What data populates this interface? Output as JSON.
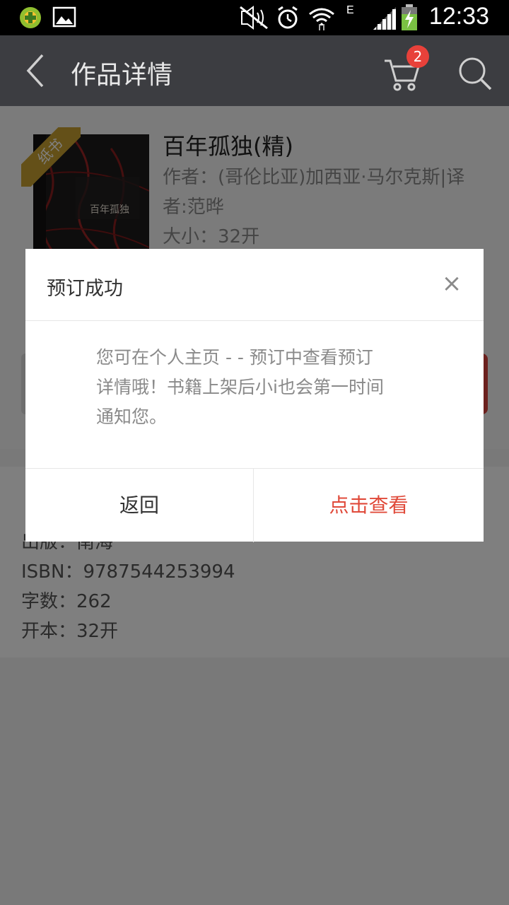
{
  "status_bar": {
    "time": "12:33",
    "icons": [
      "app-notification-icon",
      "image-notification-icon",
      "mute-icon",
      "alarm-icon",
      "wifi-icon",
      "network-e-icon",
      "signal-icon",
      "battery-charging-icon"
    ],
    "network_label": "E"
  },
  "app_bar": {
    "title": "作品详情",
    "cart_badge": "2"
  },
  "book": {
    "ribbon": "纸书",
    "cover_title": "百年孤独",
    "cover_spine": "孤独",
    "title": "百年孤独(精)",
    "author_line1": "作者：(哥伦比亚)加西亚·马尔克斯|译",
    "author_line2": "者:范晔",
    "size": "大小：32开"
  },
  "info": {
    "line_publisher": "出版：南海",
    "isbn": "ISBN：9787544253994",
    "word_count": "字数：262",
    "format": "开本：32开"
  },
  "dialog": {
    "title": "预订成功",
    "close_symbol": "×",
    "message_line1": "您可在个人主页 -  - 预订中查看预订",
    "message_line2": "详情哦！书籍上架后小i也会第一时间",
    "message_line3": "通知您。",
    "back_label": "返回",
    "view_label": "点击查看"
  },
  "colors": {
    "app_bar": "#3c3d41",
    "accent_red": "#e04a3a",
    "badge": "#e8413a",
    "ribbon": "#c9a130"
  }
}
